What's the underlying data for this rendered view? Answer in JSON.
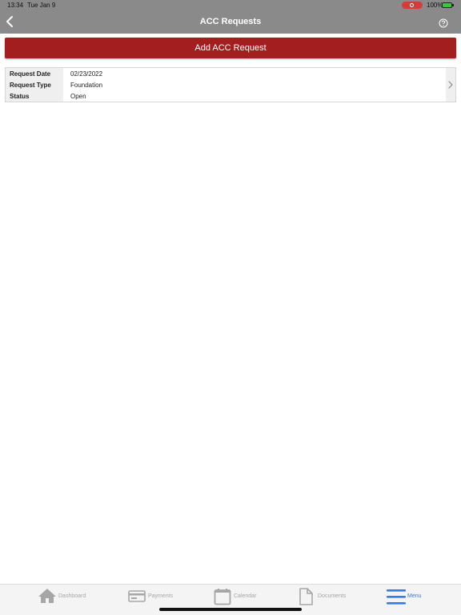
{
  "status_bar": {
    "time": "13:34",
    "date": "Tue Jan 9",
    "battery": "100%"
  },
  "header": {
    "title": "ACC Requests",
    "back_icon": "chevron-left-icon",
    "help_icon": "question-circle-icon"
  },
  "actions": {
    "add_label": "Add ACC Request"
  },
  "requests": [
    {
      "date_label": "Request Date",
      "date": "02/23/2022",
      "type_label": "Request Type",
      "type": "Foundation",
      "status_label": "Status",
      "status": "Open"
    }
  ],
  "tabs": [
    {
      "label": "Dashboard",
      "icon": "home-icon",
      "active": false
    },
    {
      "label": "Payments",
      "icon": "credit-card-icon",
      "active": false
    },
    {
      "label": "Calendar",
      "icon": "calendar-icon",
      "active": false
    },
    {
      "label": "Documents",
      "icon": "document-icon",
      "active": false
    },
    {
      "label": "Menu",
      "icon": "menu-icon",
      "active": true
    }
  ],
  "colors": {
    "header_bg": "#8a8a8a",
    "primary_button": "#a31e1e",
    "active_tab": "#3b7bd4",
    "inactive_tab": "#a6a6a6"
  }
}
